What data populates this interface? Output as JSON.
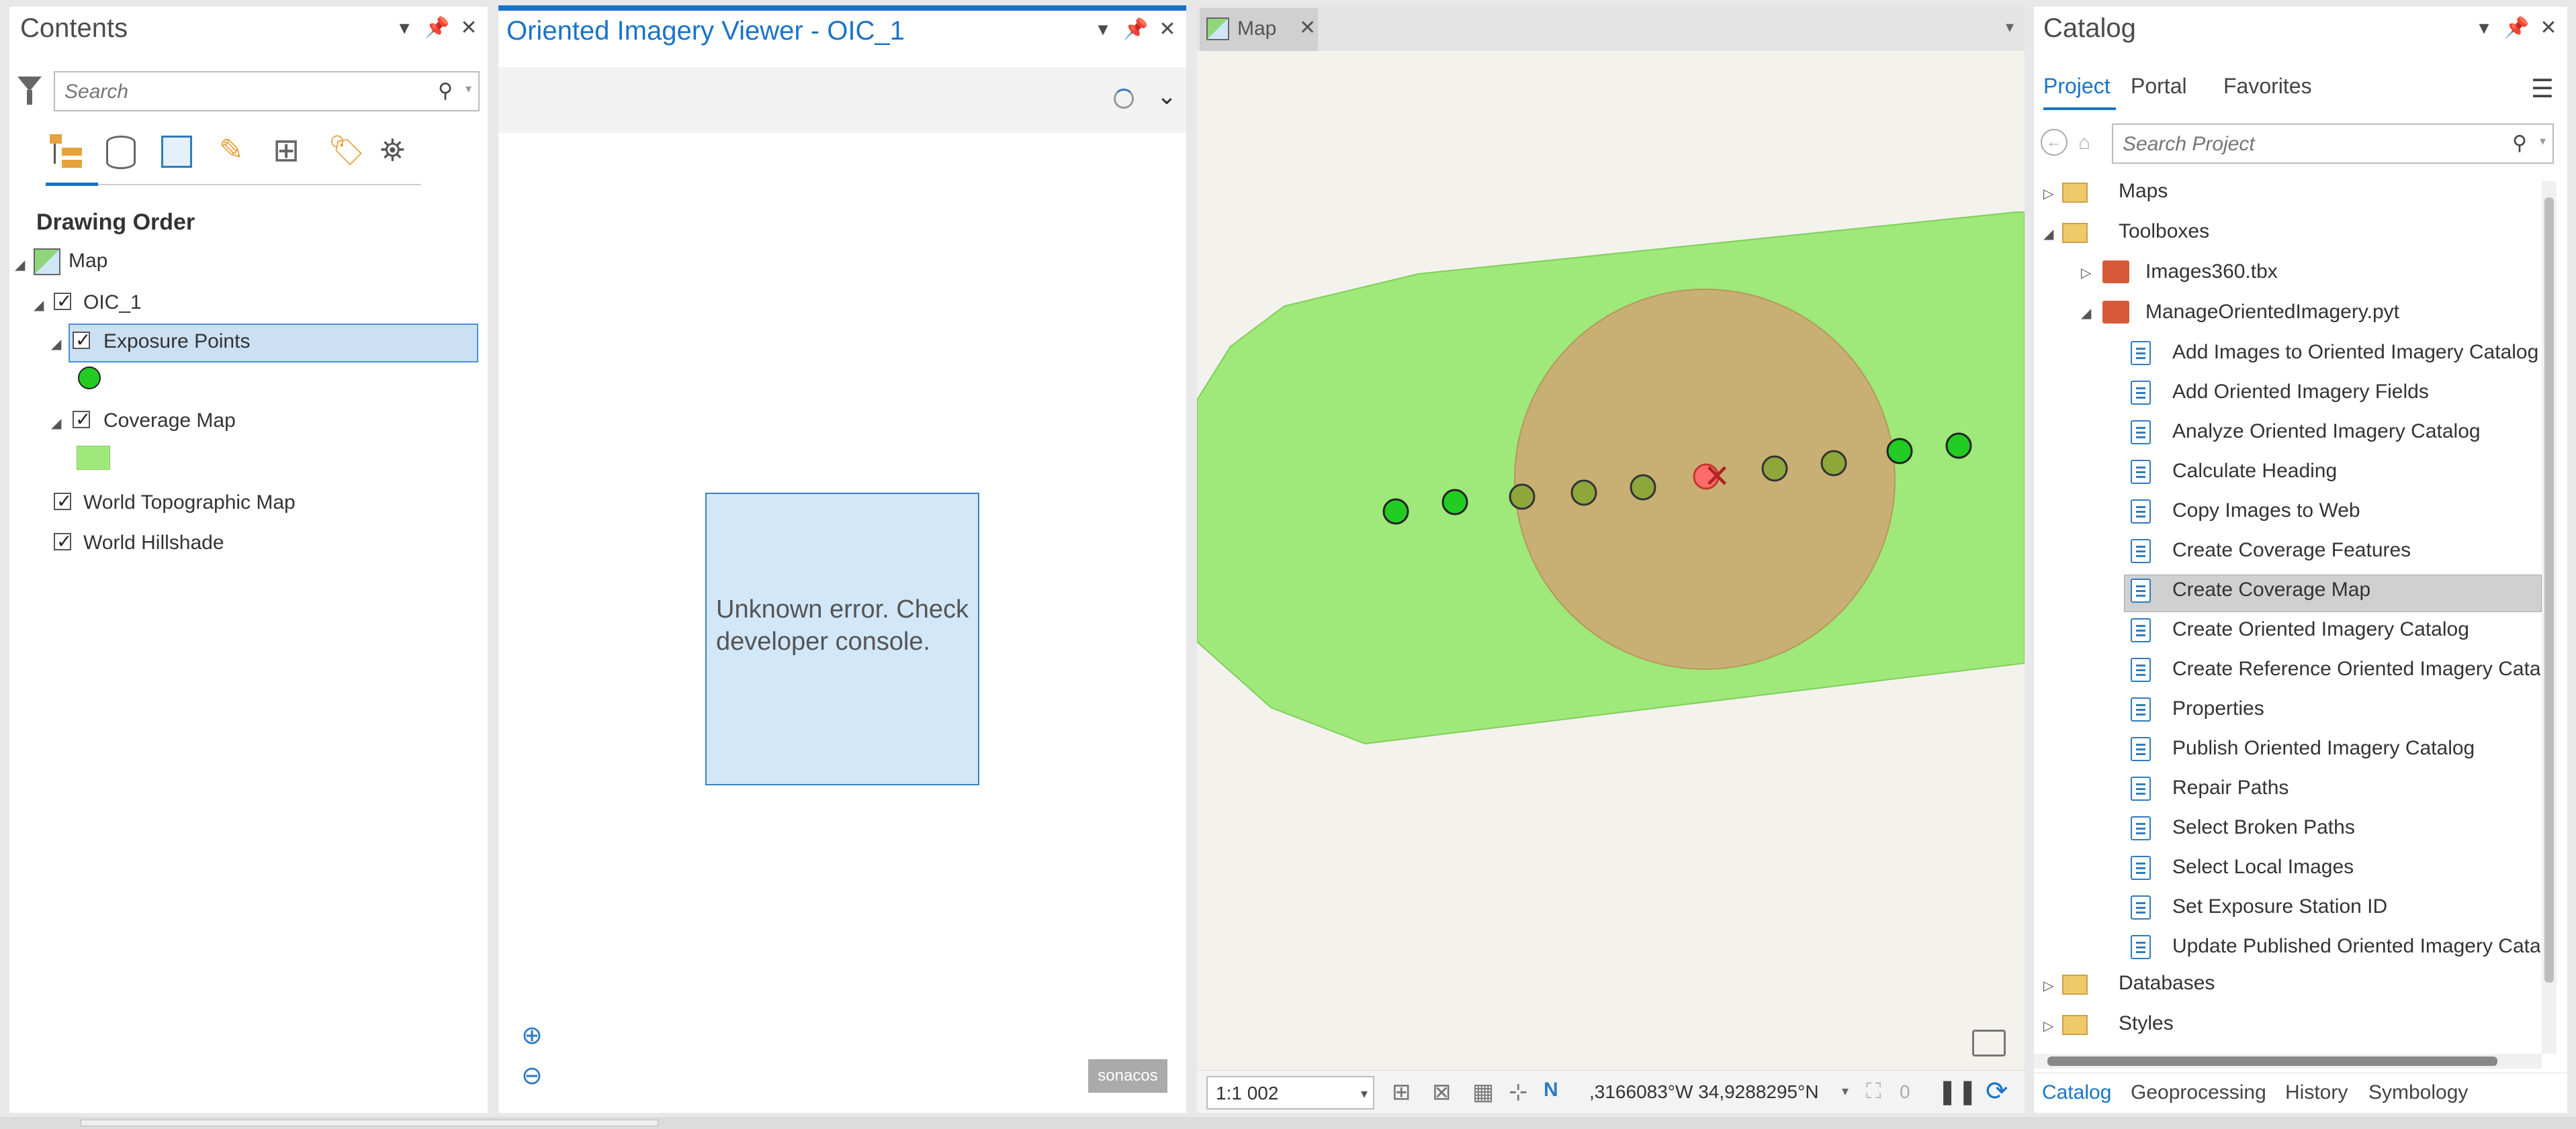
{
  "contents": {
    "title": "Contents",
    "search_placeholder": "Search",
    "drawing_order": "Drawing Order",
    "map_label": "Map",
    "layers": {
      "oic": "OIC_1",
      "exposure": "Exposure Points",
      "coverage": "Coverage Map",
      "topo": "World Topographic Map",
      "hillshade": "World Hillshade"
    }
  },
  "viewer": {
    "title": "Oriented Imagery Viewer - OIC_1",
    "error": "Unknown error. Check developer console.",
    "badge": "sonacos"
  },
  "map": {
    "tab": "Map",
    "scale": "1:1 002",
    "coords": ",3166083°W 34,9288295°N",
    "selected_count": "0"
  },
  "catalog": {
    "title": "Catalog",
    "tabs": [
      "Project",
      "Portal",
      "Favorites"
    ],
    "search_placeholder": "Search Project",
    "nodes": {
      "maps": "Maps",
      "toolboxes": "Toolboxes",
      "images360": "Images360.tbx",
      "manage": "ManageOrientedImagery.pyt",
      "databases": "Databases",
      "styles": "Styles"
    },
    "tools": [
      "Add Images to Oriented Imagery Catalog",
      "Add Oriented Imagery Fields",
      "Analyze Oriented Imagery Catalog",
      "Calculate Heading",
      "Copy Images to Web",
      "Create Coverage Features",
      "Create Coverage Map",
      "Create Oriented Imagery Catalog",
      "Create Reference Oriented Imagery Catalo",
      "Properties",
      "Publish Oriented Imagery Catalog",
      "Repair Paths",
      "Select Broken Paths",
      "Select Local Images",
      "Set Exposure Station ID",
      "Update Published Oriented Imagery Cata"
    ],
    "bottom_tabs": [
      "Catalog",
      "Geoprocessing",
      "History",
      "Symbology"
    ]
  },
  "colors": {
    "accent": "#1a73c8",
    "coverage_fill": "#9fe87a",
    "circle_fill": "#c8b074",
    "point_green": "#22cc22",
    "error_box": "#d2e7f7",
    "selection": "#cce0f4"
  }
}
